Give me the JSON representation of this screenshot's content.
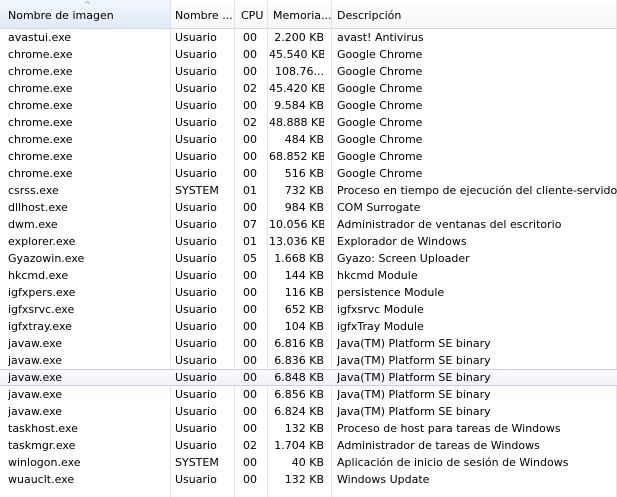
{
  "columns": {
    "name": "Nombre de imagen",
    "user": "Nombre ...",
    "cpu": "CPU",
    "memory": "Memoria...",
    "description": "Descripción"
  },
  "sort_indicator": "^",
  "rows": [
    {
      "name": "avastui.exe",
      "user": "Usuario",
      "cpu": "00",
      "memory": "2.200 KB",
      "description": "avast! Antivirus"
    },
    {
      "name": "chrome.exe",
      "user": "Usuario",
      "cpu": "00",
      "memory": "45.540 KB",
      "description": "Google Chrome"
    },
    {
      "name": "chrome.exe",
      "user": "Usuario",
      "cpu": "00",
      "memory": "108.76...",
      "description": "Google Chrome"
    },
    {
      "name": "chrome.exe",
      "user": "Usuario",
      "cpu": "02",
      "memory": "45.420 KB",
      "description": "Google Chrome"
    },
    {
      "name": "chrome.exe",
      "user": "Usuario",
      "cpu": "00",
      "memory": "9.584 KB",
      "description": "Google Chrome"
    },
    {
      "name": "chrome.exe",
      "user": "Usuario",
      "cpu": "02",
      "memory": "48.888 KB",
      "description": "Google Chrome"
    },
    {
      "name": "chrome.exe",
      "user": "Usuario",
      "cpu": "00",
      "memory": "484 KB",
      "description": "Google Chrome"
    },
    {
      "name": "chrome.exe",
      "user": "Usuario",
      "cpu": "00",
      "memory": "68.852 KB",
      "description": "Google Chrome"
    },
    {
      "name": "chrome.exe",
      "user": "Usuario",
      "cpu": "00",
      "memory": "516 KB",
      "description": "Google Chrome"
    },
    {
      "name": "csrss.exe",
      "user": "SYSTEM",
      "cpu": "01",
      "memory": "732 KB",
      "description": "Proceso en tiempo de ejecución del cliente-servidor"
    },
    {
      "name": "dllhost.exe",
      "user": "Usuario",
      "cpu": "00",
      "memory": "984 KB",
      "description": "COM Surrogate"
    },
    {
      "name": "dwm.exe",
      "user": "Usuario",
      "cpu": "07",
      "memory": "10.056 KB",
      "description": "Administrador de ventanas del escritorio"
    },
    {
      "name": "explorer.exe",
      "user": "Usuario",
      "cpu": "01",
      "memory": "13.036 KB",
      "description": "Explorador de Windows"
    },
    {
      "name": "Gyazowin.exe",
      "user": "Usuario",
      "cpu": "05",
      "memory": "1.668 KB",
      "description": "Gyazo: Screen Uploader"
    },
    {
      "name": "hkcmd.exe",
      "user": "Usuario",
      "cpu": "00",
      "memory": "144 KB",
      "description": "hkcmd Module"
    },
    {
      "name": "igfxpers.exe",
      "user": "Usuario",
      "cpu": "00",
      "memory": "116 KB",
      "description": "persistence Module"
    },
    {
      "name": "igfxsrvc.exe",
      "user": "Usuario",
      "cpu": "00",
      "memory": "652 KB",
      "description": "igfxsrvc Module"
    },
    {
      "name": "igfxtray.exe",
      "user": "Usuario",
      "cpu": "00",
      "memory": "104 KB",
      "description": "igfxTray Module"
    },
    {
      "name": "javaw.exe",
      "user": "Usuario",
      "cpu": "00",
      "memory": "6.816 KB",
      "description": "Java(TM) Platform SE binary"
    },
    {
      "name": "javaw.exe",
      "user": "Usuario",
      "cpu": "00",
      "memory": "6.836 KB",
      "description": "Java(TM) Platform SE binary"
    },
    {
      "name": "javaw.exe",
      "user": "Usuario",
      "cpu": "00",
      "memory": "6.848 KB",
      "description": "Java(TM) Platform SE binary",
      "highlighted": true
    },
    {
      "name": "javaw.exe",
      "user": "Usuario",
      "cpu": "00",
      "memory": "6.856 KB",
      "description": "Java(TM) Platform SE binary"
    },
    {
      "name": "javaw.exe",
      "user": "Usuario",
      "cpu": "00",
      "memory": "6.824 KB",
      "description": "Java(TM) Platform SE binary"
    },
    {
      "name": "taskhost.exe",
      "user": "Usuario",
      "cpu": "00",
      "memory": "132 KB",
      "description": "Proceso de host para tareas de Windows"
    },
    {
      "name": "taskmgr.exe",
      "user": "Usuario",
      "cpu": "02",
      "memory": "1.704 KB",
      "description": "Administrador de tareas de Windows"
    },
    {
      "name": "winlogon.exe",
      "user": "SYSTEM",
      "cpu": "00",
      "memory": "40 KB",
      "description": "Aplicación de inicio de sesión de Windows"
    },
    {
      "name": "wuauclt.exe",
      "user": "Usuario",
      "cpu": "00",
      "memory": "132 KB",
      "description": "Windows Update"
    }
  ]
}
